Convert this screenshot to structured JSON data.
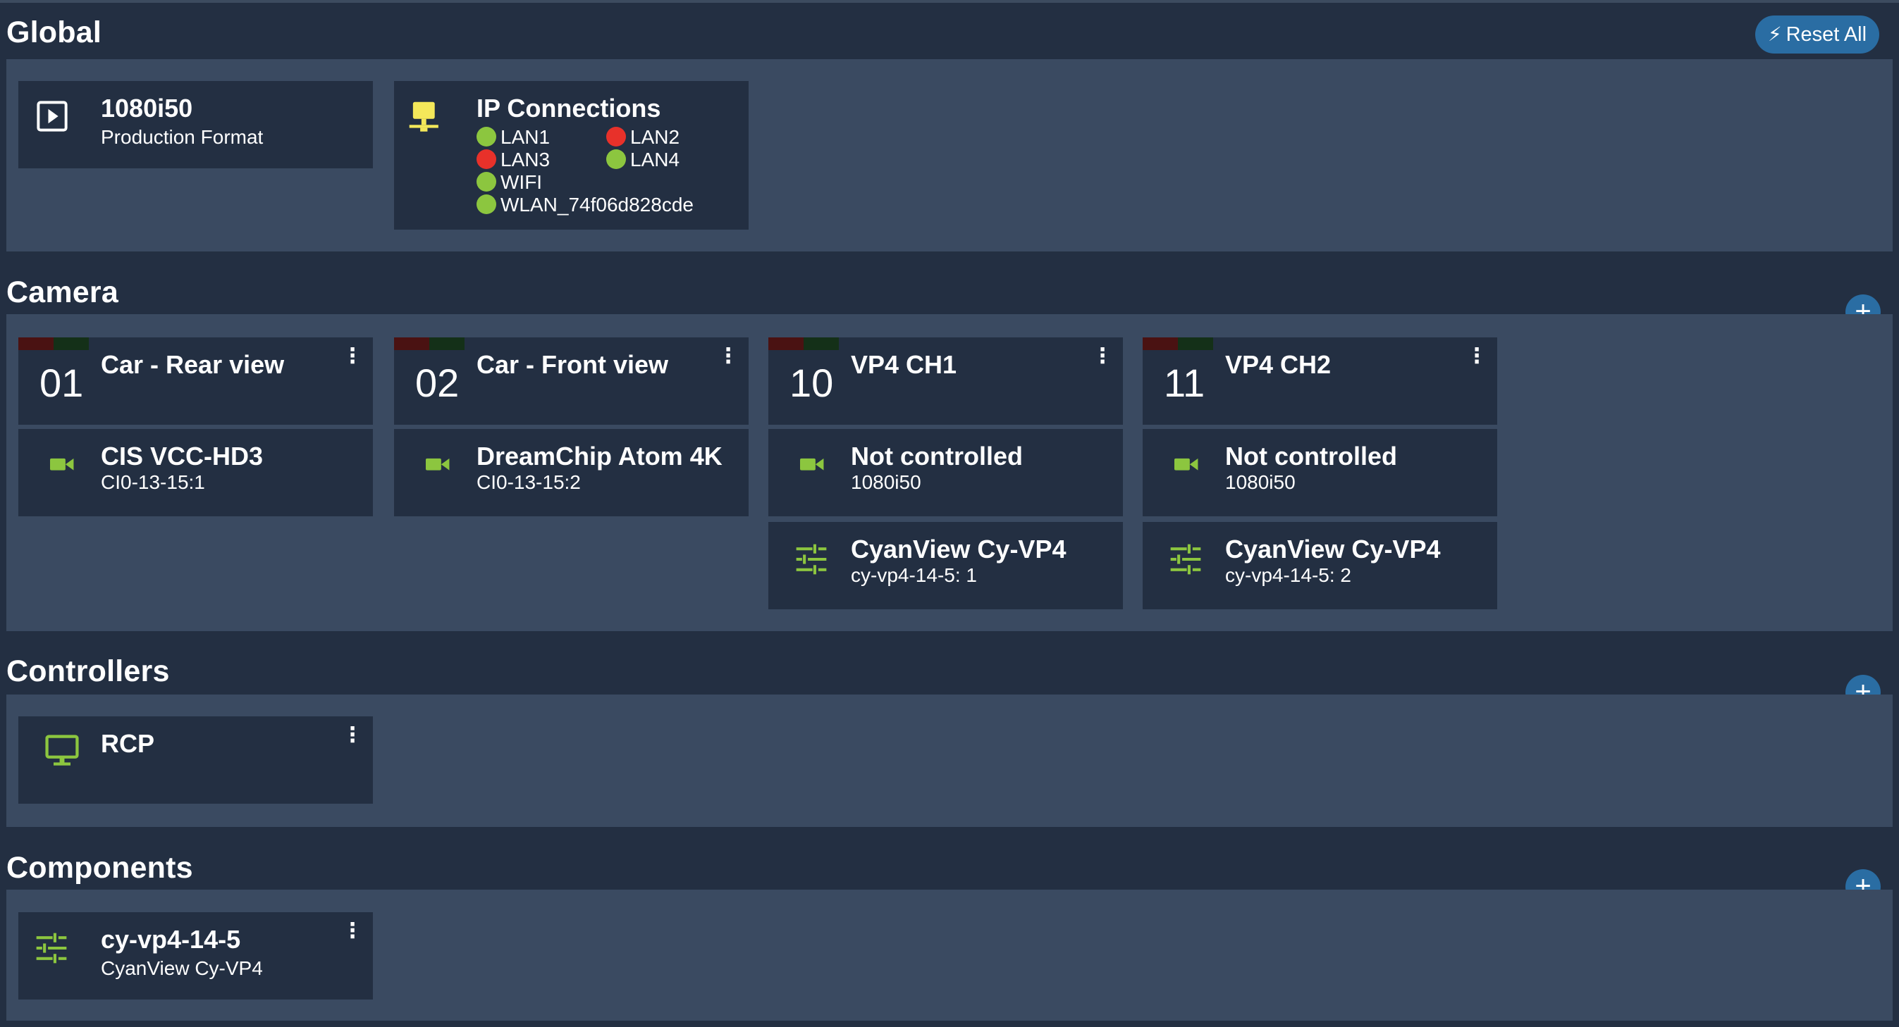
{
  "colors": {
    "background": "#232f42",
    "panel": "#3a4a61",
    "card": "#232f42",
    "accent_blue": "#2a6da3",
    "icon_green": "#8cc63f",
    "status_green": "#8cc63f",
    "status_red": "#e8312a",
    "ip_icon_yellow": "#f4e85a"
  },
  "global": {
    "title": "Global",
    "reset_label": "Reset All",
    "reset_icon": "lightning-bolt-icon",
    "format": {
      "title": "1080i50",
      "subtitle": "Production Format",
      "icon": "play-box-icon"
    },
    "ip": {
      "title": "IP Connections",
      "icon": "network-icon",
      "connections": [
        {
          "label": "LAN1",
          "status": "green"
        },
        {
          "label": "LAN2",
          "status": "red"
        },
        {
          "label": "LAN3",
          "status": "red"
        },
        {
          "label": "LAN4",
          "status": "green"
        },
        {
          "label": "WIFI",
          "status": "green"
        },
        {
          "label": "WLAN_74f06d828cde",
          "status": "green"
        }
      ]
    }
  },
  "camera": {
    "title": "Camera",
    "add_label": "+",
    "cameras": [
      {
        "number": "01",
        "name": "Car - Rear view",
        "device": {
          "title": "CIS VCC-HD3",
          "subtitle": "CI0-13-15:1",
          "icon": "video-camera-icon"
        }
      },
      {
        "number": "02",
        "name": "Car - Front view",
        "device": {
          "title": "DreamChip Atom 4K",
          "subtitle": "CI0-13-15:2",
          "icon": "video-camera-icon"
        }
      },
      {
        "number": "10",
        "name": "VP4 CH1",
        "device": {
          "title": "Not controlled",
          "subtitle": "1080i50",
          "icon": "video-camera-icon"
        },
        "processor": {
          "title": "CyanView Cy-VP4",
          "subtitle": "cy-vp4-14-5: 1",
          "icon": "sliders-icon"
        }
      },
      {
        "number": "11",
        "name": "VP4 CH2",
        "device": {
          "title": "Not controlled",
          "subtitle": "1080i50",
          "icon": "video-camera-icon"
        },
        "processor": {
          "title": "CyanView Cy-VP4",
          "subtitle": "cy-vp4-14-5: 2",
          "icon": "sliders-icon"
        }
      }
    ]
  },
  "controllers": {
    "title": "Controllers",
    "add_label": "+",
    "items": [
      {
        "title": "RCP",
        "icon": "monitor-icon"
      }
    ]
  },
  "components": {
    "title": "Components",
    "add_label": "+",
    "items": [
      {
        "title": "cy-vp4-14-5",
        "subtitle": "CyanView Cy-VP4",
        "icon": "sliders-icon"
      }
    ]
  },
  "menu_glyph": "⋮"
}
